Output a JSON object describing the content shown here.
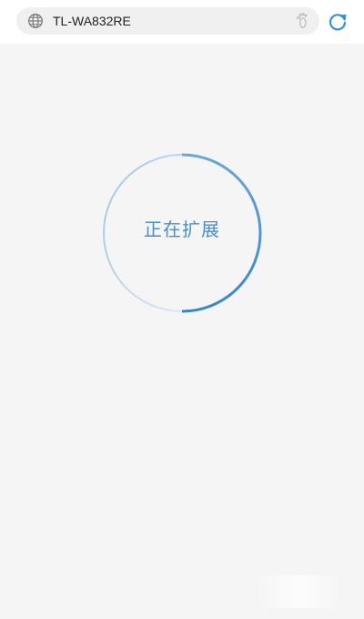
{
  "browser": {
    "address_bar": {
      "url": "TL-WA832RE",
      "globe_icon": "globe-icon",
      "footprint_icon": "footprint-icon"
    },
    "refresh_icon": "refresh-icon",
    "accent_color": "#3a8fd6"
  },
  "main": {
    "status_text": "正在扩展",
    "text_color": "#4d8fc4",
    "progress": 0.5
  }
}
